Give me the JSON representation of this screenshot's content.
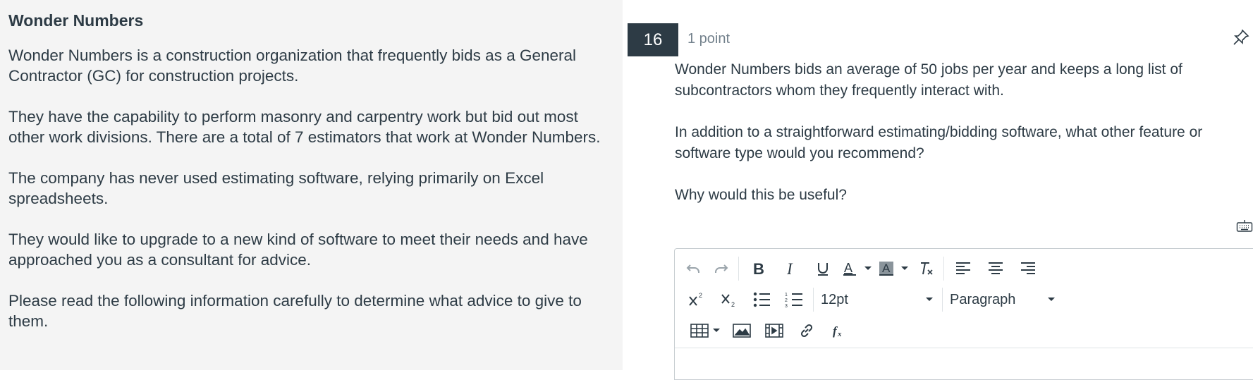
{
  "passage": {
    "title": "Wonder Numbers",
    "paragraphs": [
      "Wonder Numbers is a construction organization that frequently bids as a General Contractor (GC) for construction projects.",
      "They have the capability to perform masonry and carpentry work but bid out most other work divisions. There are a total of 7 estimators that work at Wonder Numbers.",
      "The company has never used estimating software, relying primarily on Excel spreadsheets.",
      "They would like to upgrade to a new kind of software to meet their needs and have approached you as a consultant for advice.",
      "Please read the following information carefully to determine what advice to give to them."
    ]
  },
  "question": {
    "number": "16",
    "points": "1 point",
    "paragraphs": [
      "Wonder Numbers bids an average of 50 jobs per year and keeps a long list of subcontractors whom they frequently interact with.",
      "In addition to a straightforward estimating/bidding software, what other feature or software type would you recommend?",
      "Why would this be useful?"
    ]
  },
  "editor": {
    "font_size": "12pt",
    "block_format": "Paragraph",
    "toolbar_icons": [
      "undo-icon",
      "redo-icon",
      "bold-icon",
      "italic-icon",
      "underline-icon",
      "text-color-icon",
      "background-color-icon",
      "clear-formatting-icon",
      "align-left-icon",
      "align-center-icon",
      "align-right-icon",
      "superscript-icon",
      "subscript-icon",
      "bullet-list-icon",
      "numbered-list-icon",
      "table-icon",
      "image-icon",
      "media-icon",
      "link-icon",
      "equation-icon"
    ]
  },
  "colors": {
    "left_bg": "#f4f4f4",
    "badge_bg": "#2d3b45",
    "text": "#2d3b45",
    "muted": "#73818c"
  }
}
